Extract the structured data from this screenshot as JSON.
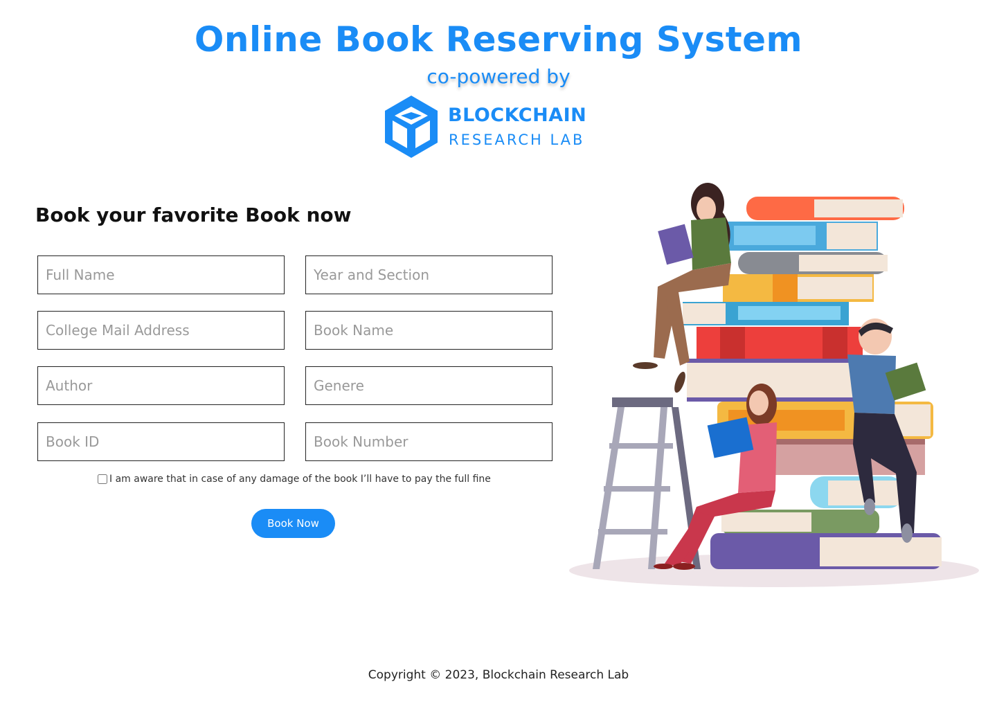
{
  "header": {
    "title": "Online Book Reserving System",
    "subtitle": "co-powered by",
    "logo": {
      "icon": "cube-logo-icon",
      "word1": "BLOCKCHAIN",
      "word2": "RESEARCH LAB",
      "color": "#1a8cf6"
    }
  },
  "form": {
    "heading": "Book your favorite Book now",
    "fields": {
      "full_name": "Full Name",
      "year_section": "Year and Section",
      "college_mail": "College Mail Address",
      "book_name": "Book Name",
      "author": "Author",
      "genre": "Genere",
      "book_id": "Book ID",
      "book_number": "Book Number"
    },
    "consent_label": "I am aware that in case of any damage of the book I’ll have to pay the full fine",
    "submit_label": "Book Now"
  },
  "footer": {
    "copyright": "Copyright © 2023, Blockchain Research Lab"
  },
  "theme": {
    "accent": "#1a8cf6"
  }
}
